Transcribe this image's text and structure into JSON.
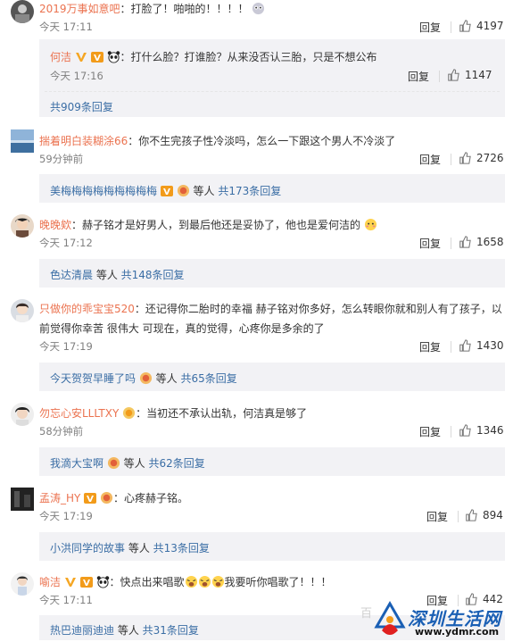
{
  "comments": [
    {
      "user": "2019万事如意吧",
      "text": "：打脸了！啪啪的！！！！",
      "time": "今天 17:11",
      "reply_label": "回复",
      "likes": "4197"
    },
    {
      "user": "揣着明白装糊涂66",
      "text": "：你不生完孩子性冷淡吗，怎么一下跟这个男人不冷淡了",
      "time": "59分钟前",
      "reply_label": "回复",
      "likes": "2726"
    },
    {
      "user": "晚晚欸",
      "text": "：赫子铭才是好男人，到最后他还是妥协了，他也是爱何洁的",
      "time": "今天 17:12",
      "reply_label": "回复",
      "likes": "1658"
    },
    {
      "user": "只做你的乖宝宝520",
      "text": "：还记得你二胎时的幸福 赫子铭对你多好，怎么转眼你就和别人有了孩子，以",
      "text2": "前觉得你幸苦 很伟大 可现在，真的觉得，心疼你是多余的了",
      "time": "今天 17:19",
      "reply_label": "回复",
      "likes": "1430"
    },
    {
      "user": "勿忘心安LLLTXY",
      "text": "：当初还不承认出轨，何洁真是够了",
      "time": "58分钟前",
      "reply_label": "回复",
      "likes": "1346"
    },
    {
      "user": "孟涛_HY",
      "text": "：心疼赫子铭。",
      "time": "今天 17:19",
      "reply_label": "回复",
      "likes": "894"
    },
    {
      "user": "喻洁",
      "text": "：快点出来唱歌",
      "text_b": "我要听你唱歌了！！！",
      "time": "今天 17:11",
      "reply_label": "回复",
      "likes": "442"
    }
  ],
  "sub_replies": [
    {
      "user": "何洁",
      "text": "：打什么脸？打谁脸？从来没否认三胎，只是不想公布",
      "time": "今天 17:16",
      "reply_label": "回复",
      "likes": "1147",
      "more": "共909条回复"
    },
    {
      "names": "美梅梅梅梅梅梅梅梅梅",
      "etc": " 等人 ",
      "more": "共173条回复"
    },
    {
      "names": "色达清晨",
      "etc": " 等人 ",
      "more": "共148条回复"
    },
    {
      "names": "今天贺贺早睡了吗",
      "etc": " 等人 ",
      "more": "共65条回复"
    },
    {
      "names": "我滴大宝啊",
      "etc": " 等人 ",
      "more": "共62条回复"
    },
    {
      "names": "小洪同学的故事",
      "etc": " 等人 ",
      "more": "共13条回复"
    },
    {
      "names": "热巴迪丽迪迪",
      "etc": " 等人 ",
      "more": "共31条回复"
    }
  ],
  "watermark": {
    "brand": "深圳生活网",
    "url": "www.ydmr.com",
    "faint": "百"
  },
  "colors": {
    "username": "#eb7350",
    "link": "#3b6ea5",
    "reply_bg": "#f2f2f5",
    "brand_red": "#e02020",
    "brand_blue": "#1a5fb4"
  }
}
